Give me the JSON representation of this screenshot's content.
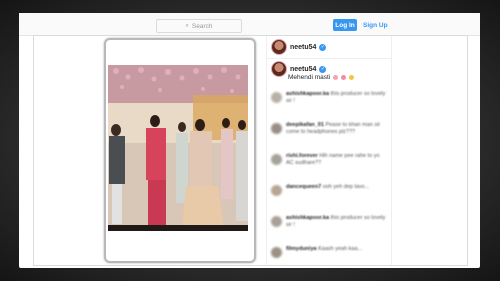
{
  "header": {
    "search_placeholder": "Search",
    "login_label": "Log In",
    "signup_label": "Sign Up"
  },
  "post": {
    "username_top": "neetu54",
    "username_caption": "neetu54",
    "caption": "Mehendi masti",
    "caption_emoji_colors": [
      "#f2a3b5",
      "#f28fa0",
      "#f5c542"
    ],
    "verified_icon": "verified-badge-icon"
  },
  "comments": [
    {
      "user": "ashishkapoor.ka",
      "text": "this producer so lovely sir !",
      "avatar_color": "#b9b1a8"
    },
    {
      "user": "deepikafan_01",
      "text": "Pease to khan man sir come to headphones plz???",
      "avatar_color": "#9a8f86"
    },
    {
      "user": "rishi.forever",
      "text": "Hih name pee rahe to yo AC sudhare??",
      "avatar_color": "#a6a29a"
    },
    {
      "user": "dancequeen7",
      "text": "ooh yeh dep lavo...",
      "avatar_color": "#b7a594"
    },
    {
      "user": "ashishkapoor.ka",
      "text": "this producer so lovely sir !",
      "avatar_color": "#aaa099"
    },
    {
      "user": "filmyduniya",
      "text": "Kaash yeah kaa...",
      "avatar_color": "#9e9284"
    }
  ]
}
